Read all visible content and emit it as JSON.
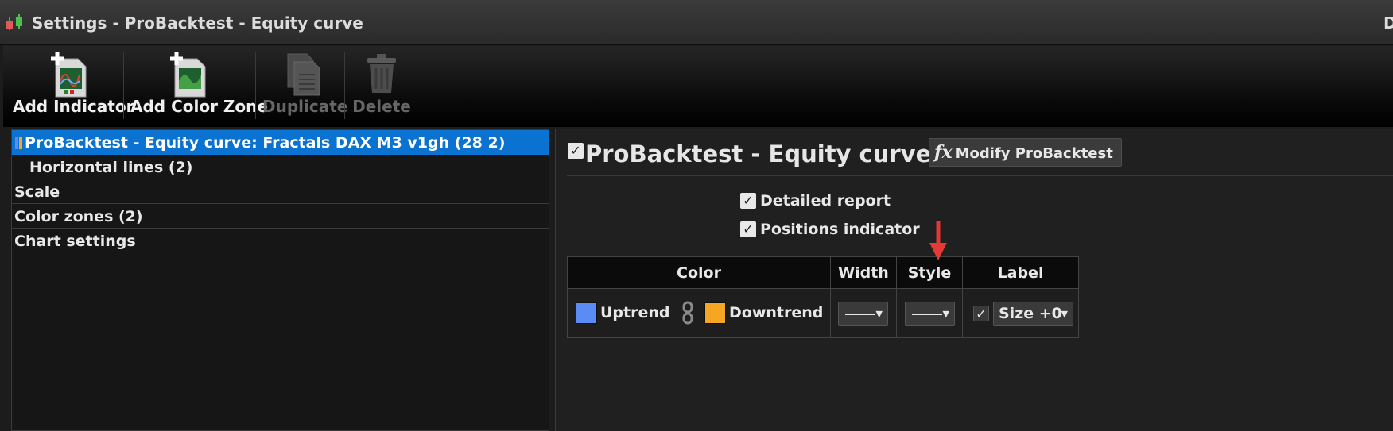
{
  "window": {
    "title": "Settings - ProBacktest - Equity curve",
    "title_right": "D"
  },
  "toolbar": {
    "buttons": [
      {
        "label": "Add Indicator",
        "icon": "add-indicator-icon",
        "enabled": true
      },
      {
        "label": "Add Color Zone",
        "icon": "add-color-zone-icon",
        "enabled": true
      },
      {
        "label": "Duplicate",
        "icon": "duplicate-icon",
        "enabled": false
      },
      {
        "label": "Delete",
        "icon": "trash-icon",
        "enabled": false
      }
    ]
  },
  "tree": {
    "items": [
      {
        "label": "ProBacktest - Equity curve: Fractals DAX M3 v1gh (28 2)",
        "selected": true
      },
      {
        "label": "Horizontal lines (2)",
        "selected": false
      },
      {
        "label": "Scale",
        "selected": false
      },
      {
        "label": "Color zones (2)",
        "selected": false
      },
      {
        "label": "Chart settings",
        "selected": false
      }
    ]
  },
  "panel": {
    "title": "ProBacktest - Equity curve",
    "enabled": true,
    "modify_button": "Modify ProBacktest",
    "modify_icon_glyph": "fx",
    "options": [
      {
        "label": "Detailed report",
        "checked": true
      },
      {
        "label": "Positions indicator",
        "checked": true
      }
    ],
    "table": {
      "headers": {
        "color": "Color",
        "width": "Width",
        "style": "Style",
        "label": "Label"
      },
      "uptrend_label": "Uptrend",
      "uptrend_color": "#5b8cf5",
      "downtrend_label": "Downtrend",
      "downtrend_color": "#f5a623",
      "label_checked": true,
      "label_size": "Size +0"
    }
  },
  "colors": {
    "selection": "#0a72d0",
    "annotation_arrow": "#e53935"
  }
}
